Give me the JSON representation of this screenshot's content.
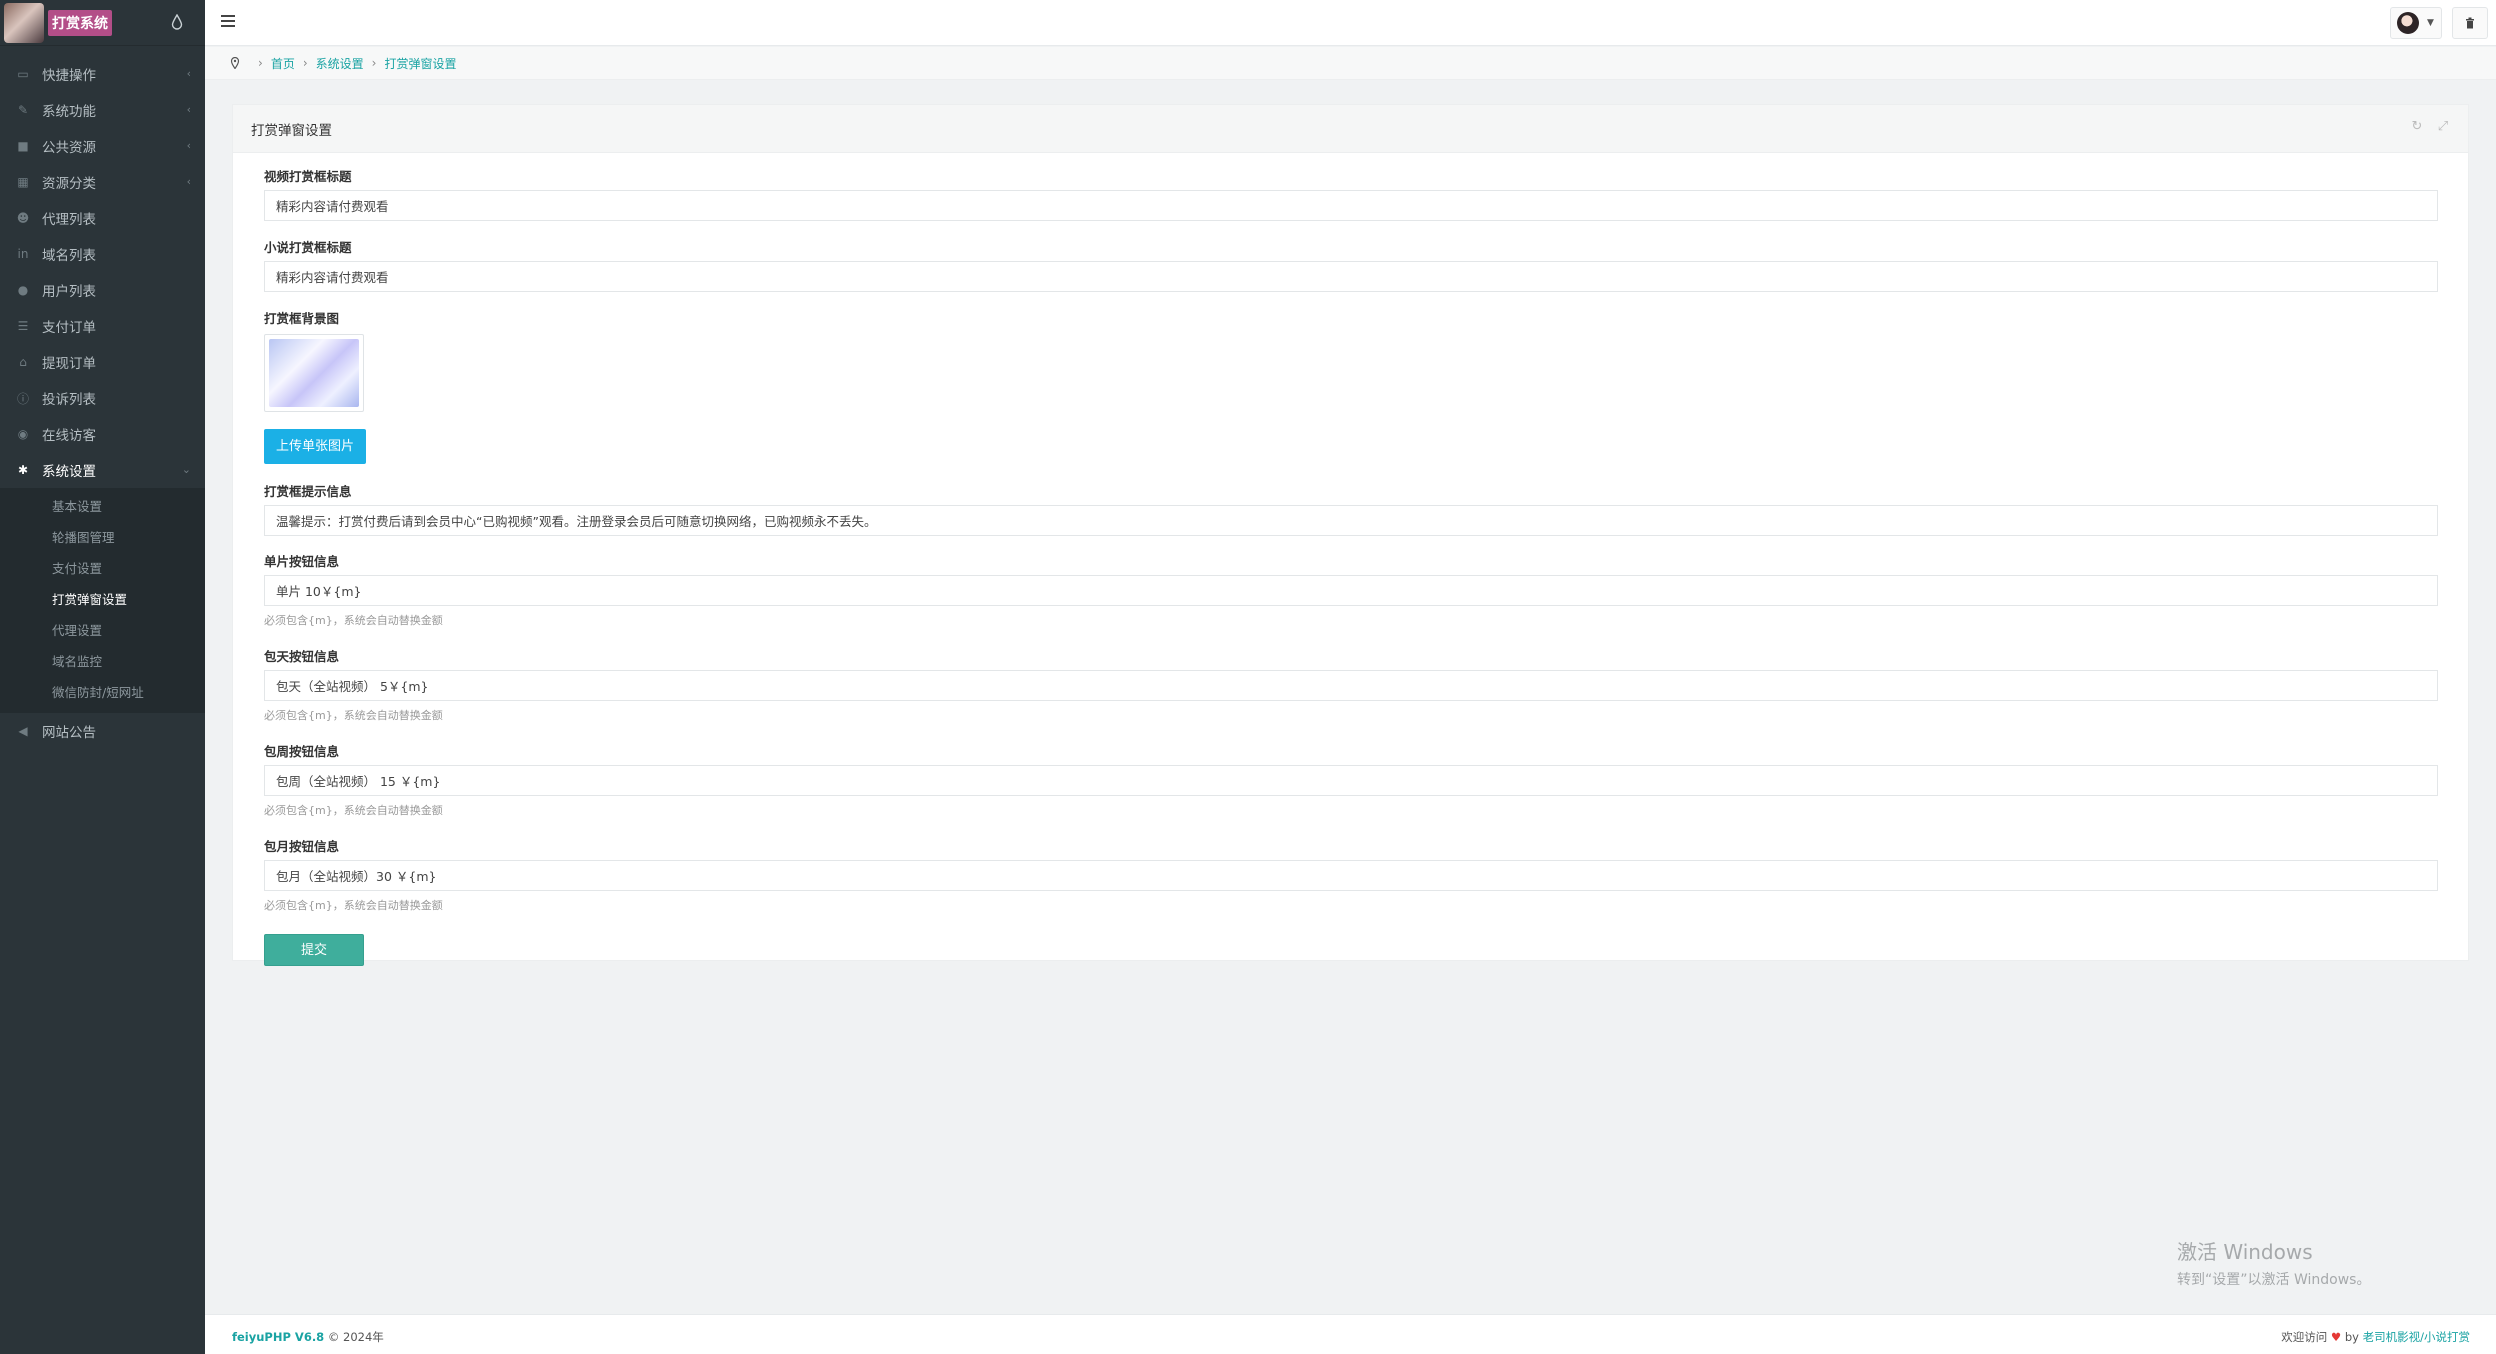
{
  "brand": {
    "name": "打赏系统"
  },
  "sidebar": {
    "items": [
      {
        "label": "快捷操作",
        "icon": "folder-icon",
        "has_arrow": true
      },
      {
        "label": "系统功能",
        "icon": "wrench-icon",
        "has_arrow": true
      },
      {
        "label": "公共资源",
        "icon": "video-icon",
        "has_arrow": true
      },
      {
        "label": "资源分类",
        "icon": "grid-icon",
        "has_arrow": true
      },
      {
        "label": "代理列表",
        "icon": "users-icon"
      },
      {
        "label": "域名列表",
        "icon": "linkedin-icon"
      },
      {
        "label": "用户列表",
        "icon": "user-icon"
      },
      {
        "label": "支付订单",
        "icon": "list-icon"
      },
      {
        "label": "提现订单",
        "icon": "bank-icon"
      },
      {
        "label": "投诉列表",
        "icon": "info-icon"
      },
      {
        "label": "在线访客",
        "icon": "globe-icon"
      },
      {
        "label": "系统设置",
        "icon": "gear-icon",
        "expanded": true
      }
    ],
    "sub_items": [
      "基本设置",
      "轮播图管理",
      "支付设置",
      "打赏弹窗设置",
      "代理设置",
      "域名监控",
      "微信防封/短网址"
    ],
    "last_item": {
      "label": "网站公告",
      "icon": "bullhorn-icon"
    }
  },
  "breadcrumb": [
    "首页",
    "系统设置",
    "打赏弹窗设置"
  ],
  "panel": {
    "title": "打赏弹窗设置",
    "fields": {
      "video_title_label": "视频打赏框标题",
      "video_title_value": "精彩内容请付费观看",
      "novel_title_label": "小说打赏框标题",
      "novel_title_value": "精彩内容请付费观看",
      "bg_label": "打赏框背景图",
      "upload_label": "上传单张图片",
      "tip_label": "打赏框提示信息",
      "tip_value": "温馨提示：打赏付费后请到会员中心“已购视频”观看。注册登录会员后可随意切换网络，已购视频永不丢失。",
      "single_label": "单片按钮信息",
      "single_value": "单片   10￥{m}",
      "day_label": "包天按钮信息",
      "day_value": "包天（全站视频）   5￥{m}",
      "week_label": "包周按钮信息",
      "week_value": "包周（全站视频）  15  ￥{m}",
      "month_label": "包月按钮信息",
      "month_value": "包月（全站视频）30    ￥{m}",
      "help_text": "必须包含{m}，系统会自动替换金额"
    },
    "submit_label": "提交"
  },
  "footer": {
    "brand": "feiyuPHP V6.8",
    "copyright": "© 2024年",
    "welcome": "欢迎访问",
    "by": "by",
    "link": "老司机影视/小说打赏"
  },
  "watermark": {
    "line1": "激活 Windows",
    "line2": "转到“设置”以激活 Windows。"
  }
}
